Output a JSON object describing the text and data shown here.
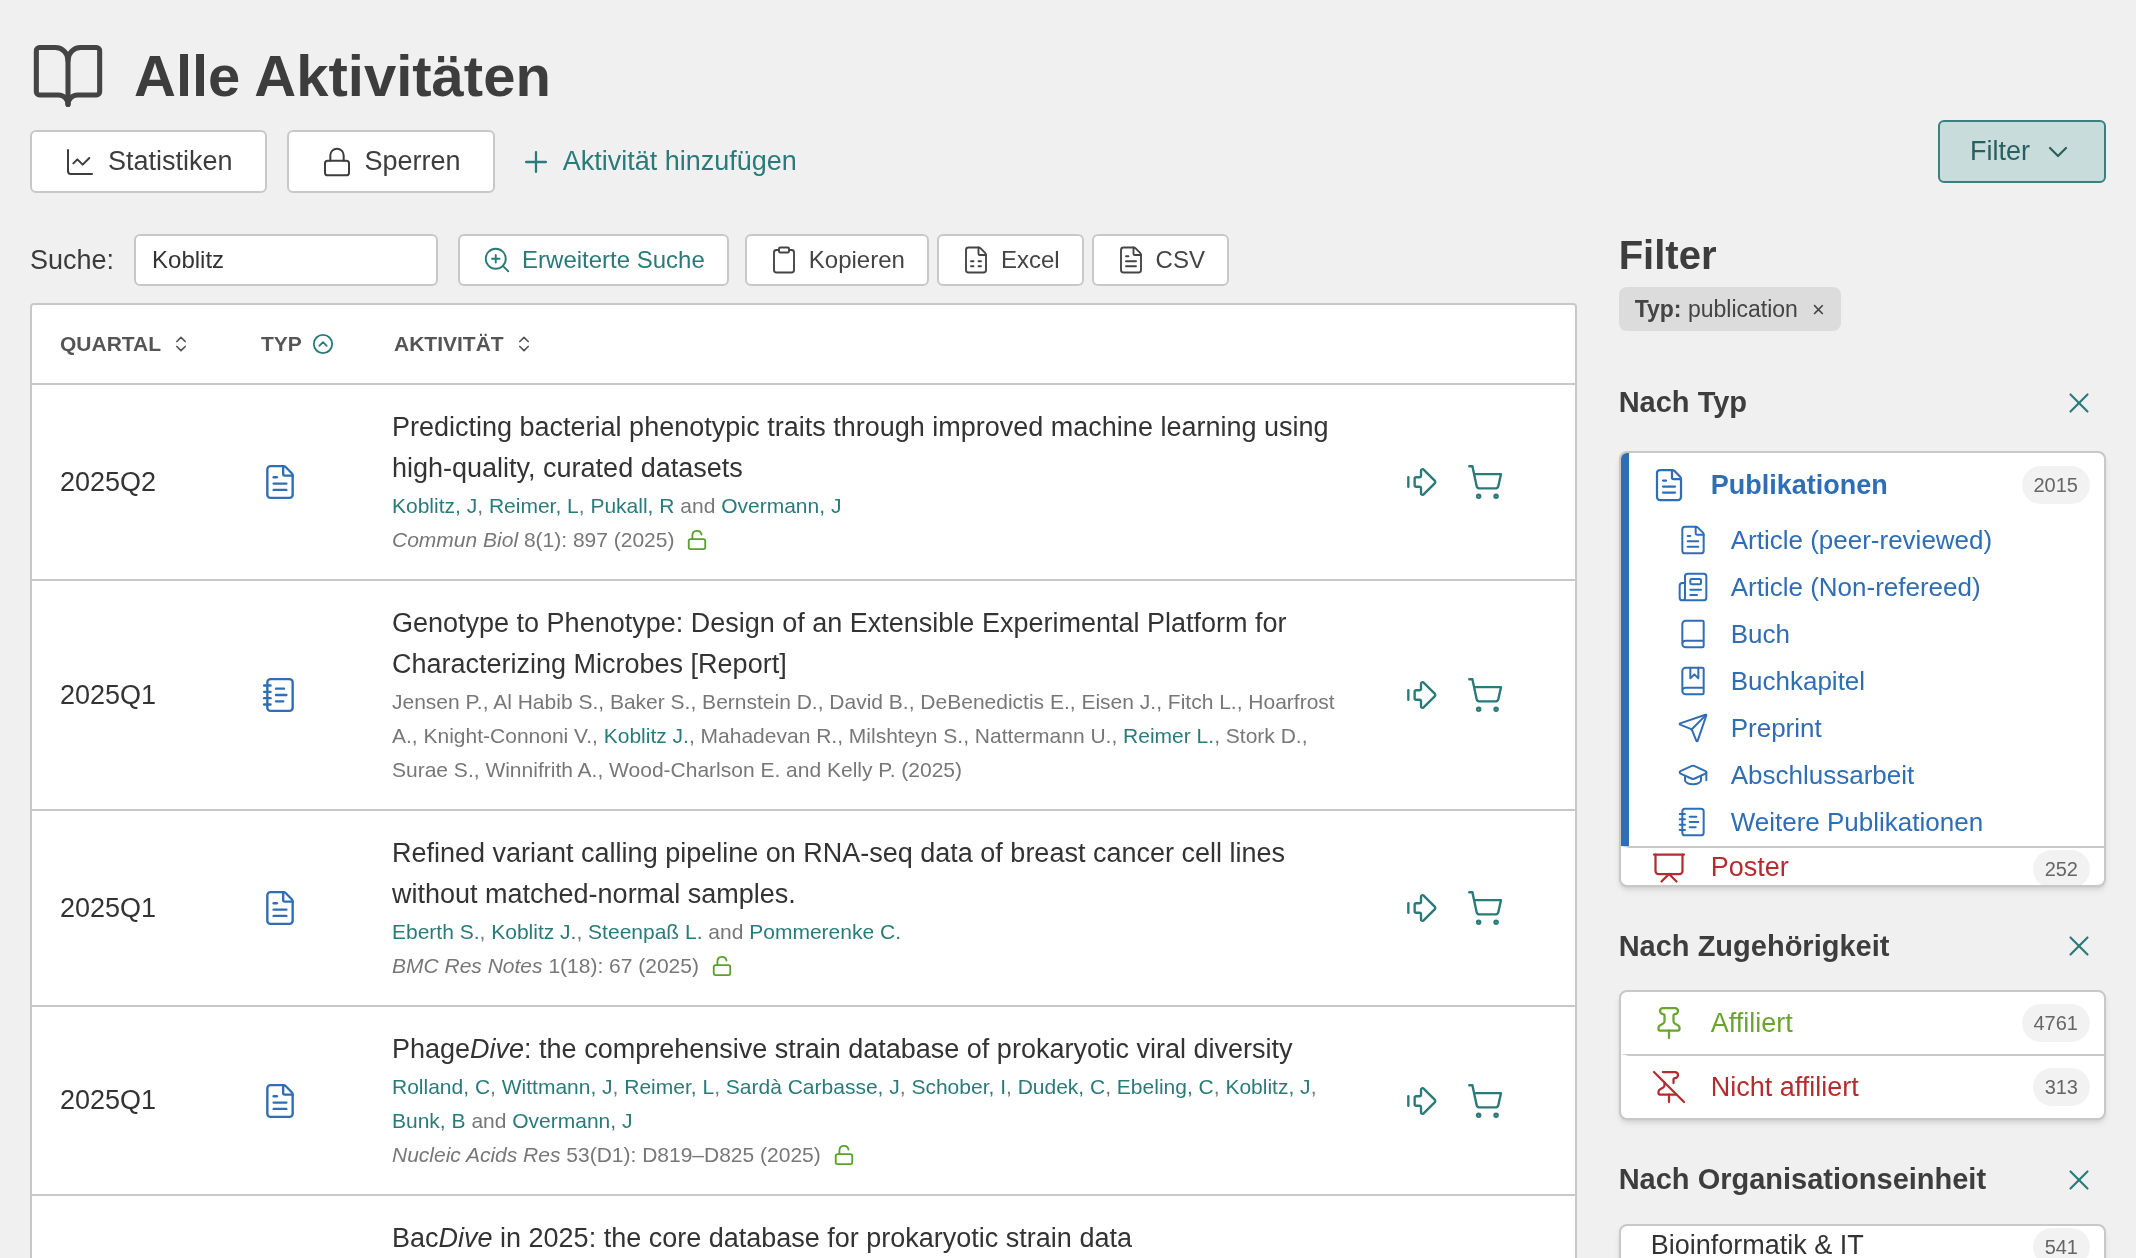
{
  "page": {
    "title": "Alle Aktivitäten"
  },
  "toolbar": [
    {
      "label": "Statistiken",
      "kind": "stats"
    },
    {
      "label": "Sperren",
      "kind": "lock"
    },
    {
      "label": "Aktivität hinzufügen",
      "kind": "add"
    }
  ],
  "filter_button": {
    "label": "Filter"
  },
  "search": {
    "label": "Suche:",
    "value": "Koblitz"
  },
  "search_actions": [
    {
      "label": "Erweiterte Suche",
      "kind": "advanced"
    },
    {
      "label": "Kopieren",
      "kind": "copy"
    },
    {
      "label": "Excel",
      "kind": "excel"
    },
    {
      "label": "CSV",
      "kind": "csv"
    }
  ],
  "table": {
    "columns": [
      {
        "label": "QUARTAL",
        "kind": "both"
      },
      {
        "label": "TYP",
        "kind": "up"
      },
      {
        "label": "AKTIVITÄT",
        "kind": "both"
      }
    ],
    "rows": [
      {
        "quarter": "2025Q2",
        "kind": "article",
        "title": [
          {
            "text": "Predicting bacterial phenotypic traits through improved machine learning using high-quality, curated datasets",
            "italic": false
          }
        ],
        "authors": [
          {
            "text": "Koblitz, J",
            "affiliated": true
          },
          {
            "text": ", ",
            "affiliated": false
          },
          {
            "text": "Reimer, L",
            "affiliated": true
          },
          {
            "text": ", ",
            "affiliated": false
          },
          {
            "text": "Pukall, R",
            "affiliated": true
          },
          {
            "text": " and ",
            "affiliated": false
          },
          {
            "text": "Overmann, J",
            "affiliated": true
          }
        ],
        "source": "*Commun Biol* 8(1): 897 (2025)",
        "open_access": true
      },
      {
        "quarter": "2025Q1",
        "kind": "other",
        "title": [
          {
            "text": "Genotype to Phenotype: Design of an Extensible Experimental Platform for Characterizing Microbes [Report]",
            "italic": false
          }
        ],
        "authors": [
          {
            "text": "Jensen P., Al Habib S., Baker S., Bernstein D., David B., DeBenedictis E., Eisen J., Fitch L., Hoarfrost A., Knight-Connoni V., ",
            "affiliated": false
          },
          {
            "text": "Koblitz J.",
            "affiliated": true
          },
          {
            "text": ", Mahadevan R., Milshteyn S., Nattermann U., ",
            "affiliated": false
          },
          {
            "text": "Reimer L.",
            "affiliated": true
          },
          {
            "text": ", Stork D., Surae S., Winnifrith A., Wood-Charlson E. and Kelly P. (2025)",
            "affiliated": false
          }
        ],
        "open_access": false
      },
      {
        "quarter": "2025Q1",
        "kind": "article",
        "title": [
          {
            "text": "Refined variant calling pipeline on RNA-seq data of breast cancer cell lines without matched-normal samples.",
            "italic": false
          }
        ],
        "authors": [
          {
            "text": "Eberth S.",
            "affiliated": true
          },
          {
            "text": ", ",
            "affiliated": false
          },
          {
            "text": "Koblitz J.",
            "affiliated": true
          },
          {
            "text": ", ",
            "affiliated": false
          },
          {
            "text": "Steenpaß L.",
            "affiliated": true
          },
          {
            "text": " and ",
            "affiliated": false
          },
          {
            "text": "Pommerenke C.",
            "affiliated": true
          }
        ],
        "source": "*BMC Res Notes* 1(18): 67 (2025)",
        "open_access": true
      },
      {
        "quarter": "2025Q1",
        "kind": "article",
        "title": [
          {
            "text": "Phage",
            "italic": false
          },
          {
            "text": "Dive",
            "italic": true
          },
          {
            "text": ": the comprehensive strain database of prokaryotic viral diversity",
            "italic": false
          }
        ],
        "authors": [
          {
            "text": "Rolland, C",
            "affiliated": true
          },
          {
            "text": ", ",
            "affiliated": false
          },
          {
            "text": "Wittmann, J",
            "affiliated": true
          },
          {
            "text": ", ",
            "affiliated": false
          },
          {
            "text": "Reimer, L",
            "affiliated": true
          },
          {
            "text": ", ",
            "affiliated": false
          },
          {
            "text": "Sardà Carbasse, J",
            "affiliated": true
          },
          {
            "text": ", ",
            "affiliated": false
          },
          {
            "text": "Schober, I",
            "affiliated": true
          },
          {
            "text": ", ",
            "affiliated": false
          },
          {
            "text": "Dudek, C",
            "affiliated": true
          },
          {
            "text": ", ",
            "affiliated": false
          },
          {
            "text": "Ebeling, C",
            "affiliated": true
          },
          {
            "text": ", ",
            "affiliated": false
          },
          {
            "text": "Koblitz, J",
            "affiliated": true
          },
          {
            "text": ", ",
            "affiliated": false
          },
          {
            "text": "Bunk, B",
            "affiliated": true
          },
          {
            "text": " and ",
            "affiliated": false
          },
          {
            "text": "Overmann, J",
            "affiliated": true
          }
        ],
        "source": "*Nucleic Acids Res* 53(D1): D819–D825 (2025)",
        "open_access": true
      },
      {
        "title": [
          {
            "text": "Bac",
            "italic": false
          },
          {
            "text": "Dive",
            "italic": true
          },
          {
            "text": " in 2025: the core database for prokaryotic strain data",
            "italic": false
          }
        ],
        "authors": []
      }
    ]
  },
  "sidebar": {
    "title": "Filter",
    "chip": {
      "label": "**Typ:** publication",
      "remove": "×"
    },
    "sections": [
      {
        "title": "Nach Typ",
        "items": [
          {
            "label": "Publikationen",
            "count": "2015",
            "kind": "article",
            "color": "#2f6db5",
            "selected": true,
            "children": [
              {
                "label": "Article (peer-reviewed)",
                "kind": "article"
              },
              {
                "label": "Article (Non-refereed)",
                "kind": "non_refereed"
              },
              {
                "label": "Buch",
                "kind": "book"
              },
              {
                "label": "Buchkapitel",
                "kind": "chapter"
              },
              {
                "label": "Preprint",
                "kind": "preprint"
              },
              {
                "label": "Abschlussarbeit",
                "kind": "thesis"
              },
              {
                "label": "Weitere Publikationen",
                "kind": "other"
              }
            ]
          },
          {
            "label": "Poster",
            "count": "252",
            "kind": "poster",
            "color": "#b32d2e",
            "selected": false
          }
        ]
      },
      {
        "title": "Nach Zugehörigkeit",
        "items": [
          {
            "label": "Affiliert",
            "count": "4761",
            "kind": "pin",
            "color": "#6aa42e",
            "selected": false
          },
          {
            "label": "Nicht affiliert",
            "count": "313",
            "kind": "pin_off",
            "color": "#b32d2e",
            "selected": false
          }
        ]
      },
      {
        "title": "Nach Organisationseinheit",
        "items": [
          {
            "label": "Bioinformatik & IT",
            "count": "541",
            "kind": "none",
            "color": "#333333",
            "selected": false
          }
        ]
      }
    ]
  }
}
